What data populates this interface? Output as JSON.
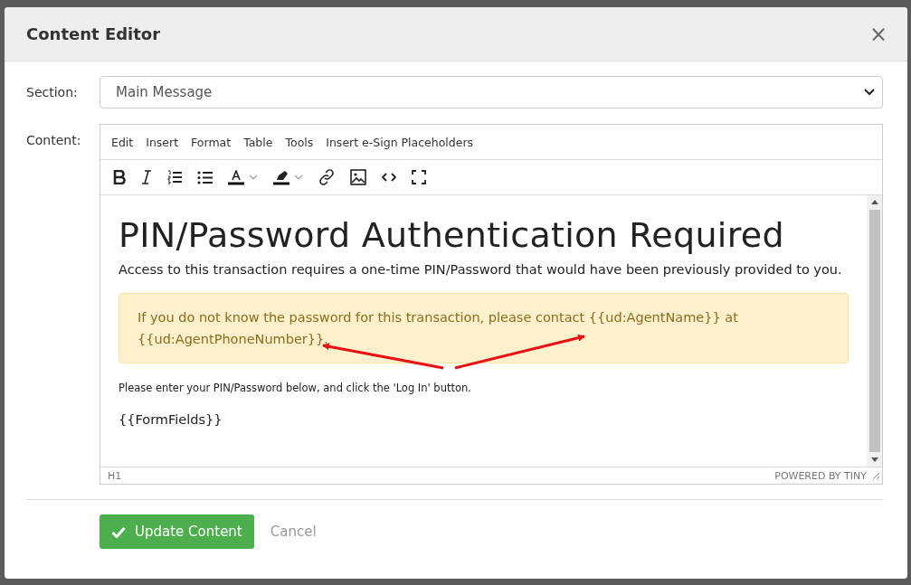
{
  "dialog": {
    "title": "Content Editor",
    "close": "×"
  },
  "section": {
    "label": "Section:",
    "value": "Main Message"
  },
  "content": {
    "label": "Content:",
    "menu": [
      "Edit",
      "Insert",
      "Format",
      "Table",
      "Tools",
      "Insert e-Sign Placeholders"
    ],
    "toolbar": [
      {
        "kind": "bold"
      },
      {
        "kind": "italic"
      },
      {
        "kind": "ordered-list"
      },
      {
        "kind": "bullet-list"
      },
      {
        "kind": "text-color"
      },
      {
        "kind": "caret"
      },
      {
        "kind": "highlight"
      },
      {
        "kind": "caret"
      },
      {
        "kind": "link"
      },
      {
        "kind": "image"
      },
      {
        "kind": "code"
      },
      {
        "kind": "fullscreen"
      }
    ],
    "heading": "PIN/Password Authentication Required",
    "intro": "Access to this transaction requires a one-time PIN/Password that would have been previously provided to you.",
    "alert": "If you do not know the password for this transaction, please contact {{ud:AgentName}} at {{ud:AgentPhoneNumber}}.",
    "instruction": "Please enter your PIN/Password below, and click the 'Log In' button.",
    "fields": "{{FormFields}}",
    "status_path": "H1",
    "branding": "POWERED BY TINY"
  },
  "buttons": {
    "primary": "Update Content",
    "secondary": "Cancel"
  }
}
